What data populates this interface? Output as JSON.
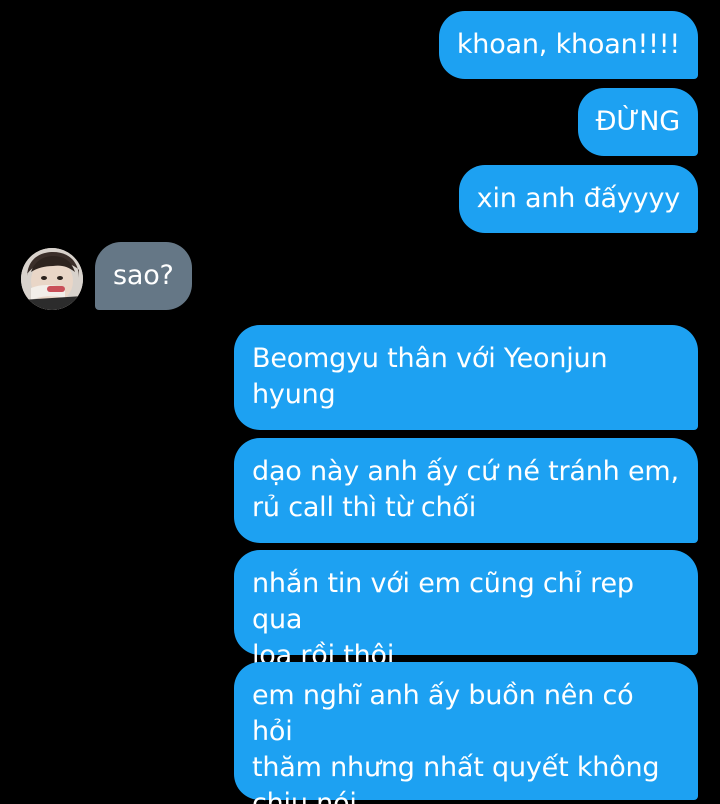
{
  "conversation": {
    "messages": [
      {
        "sender": "me",
        "text": "khoan, khoan!!!!"
      },
      {
        "sender": "me",
        "text": "ĐỪNG"
      },
      {
        "sender": "me",
        "text": "xin anh đấyyyy"
      },
      {
        "sender": "other",
        "text": "sao?"
      },
      {
        "sender": "me",
        "text": "Beomgyu thân với Yeonjun\nhyung"
      },
      {
        "sender": "me",
        "text": "dạo này anh ấy cứ né tránh em,\nrủ call thì từ chối"
      },
      {
        "sender": "me",
        "text": "nhắn tin với em cũng chỉ rep qua\nloa rồi thôi"
      },
      {
        "sender": "me",
        "text": "em nghĩ anh ấy buồn nên có hỏi\nthăm nhưng nhất quyết không\nchịu nói"
      }
    ]
  },
  "colors": {
    "background": "#000000",
    "outgoing_bubble": "#1da1f2",
    "incoming_bubble": "#657786",
    "text": "#ffffff"
  },
  "icons": {
    "avatar": "user-avatar-photo"
  }
}
